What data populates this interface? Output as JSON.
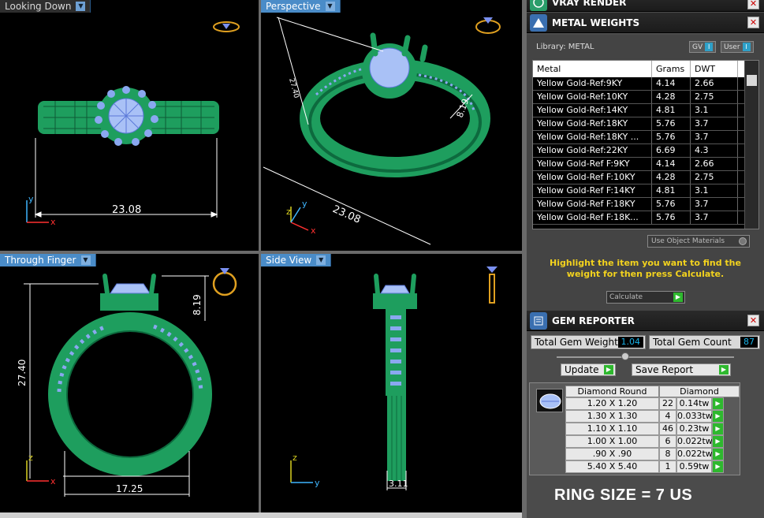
{
  "viewports": {
    "top_left": {
      "tab": "Looking Down",
      "dim_width": "23.08",
      "axis_y": "y",
      "axis_x": "x"
    },
    "top_right": {
      "tab": "Perspective",
      "dim_width": "23.08",
      "dim_height": "8.19",
      "dim_side": "27.40",
      "axis_z": "z",
      "axis_y": "y",
      "axis_x": "x"
    },
    "bottom_left": {
      "tab": "Through Finger",
      "dim_height": "27.40",
      "dim_top": "8.19",
      "dim_width": "17.25",
      "axis_z": "z",
      "axis_x": "x"
    },
    "bottom_right": {
      "tab": "Side View",
      "dim_width": "3.11",
      "axis_z": "z",
      "axis_y": "y"
    }
  },
  "vray": {
    "title": "VRAY RENDER"
  },
  "metal_weights": {
    "title": "METAL WEIGHTS",
    "library_label": "Library: METAL",
    "gv_label": "GV",
    "user_label": "User",
    "toggle_glyph": "I",
    "headers": [
      "Metal",
      "Grams",
      "DWT"
    ],
    "rows": [
      [
        "Yellow Gold-Ref:9KY",
        "4.14",
        "2.66"
      ],
      [
        "Yellow Gold-Ref:10KY",
        "4.28",
        "2.75"
      ],
      [
        "Yellow Gold-Ref:14KY",
        "4.81",
        "3.1"
      ],
      [
        "Yellow Gold-Ref:18KY",
        "5.76",
        "3.7"
      ],
      [
        "Yellow Gold-Ref:18KY ...",
        "5.76",
        "3.7"
      ],
      [
        "Yellow Gold-Ref:22KY",
        "6.69",
        "4.3"
      ],
      [
        "Yellow Gold-Ref F:9KY",
        "4.14",
        "2.66"
      ],
      [
        "Yellow Gold-Ref F:10KY",
        "4.28",
        "2.75"
      ],
      [
        "Yellow Gold-Ref F:14KY",
        "4.81",
        "3.1"
      ],
      [
        "Yellow Gold-Ref F:18KY",
        "5.76",
        "3.7"
      ],
      [
        "Yellow Gold-Ref F:18K...",
        "5.76",
        "3.7"
      ]
    ],
    "use_object_materials": "Use Object Materials",
    "hint": "Highlight the item you want to find the weight for then press Calculate.",
    "calculate_label": "Calculate"
  },
  "gem_reporter": {
    "title": "GEM REPORTER",
    "total_weight_label": "Total Gem Weight",
    "total_weight_value": "1.04",
    "total_count_label": "Total Gem Count",
    "total_count_value": "87",
    "update_label": "Update",
    "save_report_label": "Save Report",
    "col_shape": "Diamond Round",
    "col_material": "Diamond",
    "gems": [
      [
        "1.20 X 1.20",
        "22",
        "0.14tw"
      ],
      [
        "1.30 X 1.30",
        "4",
        "0.033tw"
      ],
      [
        "1.10 X 1.10",
        "46",
        "0.23tw"
      ],
      [
        "1.00 X 1.00",
        "6",
        "0.022tw"
      ],
      [
        ".90 X .90",
        "8",
        "0.022tw"
      ],
      [
        "5.40 X 5.40",
        "1",
        "0.59tw"
      ]
    ]
  },
  "ring_size": "RING SIZE = 7 US",
  "colors": {
    "metal": "#1e9e5e",
    "gem": "#8aa8f0",
    "accent": "#4a8cc8",
    "hint": "#f2d21e",
    "go": "#2eb82e"
  },
  "icons": {
    "close": "close-icon",
    "go": "play-arrow-icon"
  }
}
